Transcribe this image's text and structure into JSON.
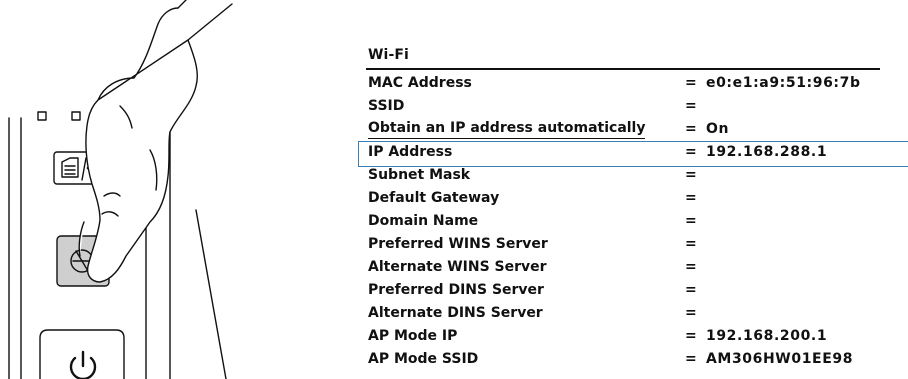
{
  "illustration": {
    "icons": [
      "hand-icon",
      "copy-settings-icon",
      "stop-icon",
      "power-icon"
    ]
  },
  "report": {
    "title": "Wi-Fi",
    "separator": "=",
    "rows": [
      {
        "label": "MAC Address",
        "value": "e0:e1:a9:51:96:7b"
      },
      {
        "label": "SSID",
        "value": ""
      },
      {
        "label": "Obtain an IP address automatically",
        "value": "On"
      },
      {
        "label": "IP Address",
        "value": "192.168.288.1"
      },
      {
        "label": "Subnet Mask",
        "value": ""
      },
      {
        "label": "Default Gateway",
        "value": ""
      },
      {
        "label": "Domain Name",
        "value": ""
      },
      {
        "label": "Preferred WINS Server",
        "value": ""
      },
      {
        "label": "Alternate WINS Server",
        "value": ""
      },
      {
        "label": "Preferred DINS Server",
        "value": ""
      },
      {
        "label": "Alternate DINS Server",
        "value": ""
      },
      {
        "label": "AP Mode IP",
        "value": "192.168.200.1"
      },
      {
        "label": "AP Mode SSID",
        "value": "AM306HW01EE98"
      }
    ],
    "highlight_color": "#3b7fb5"
  }
}
